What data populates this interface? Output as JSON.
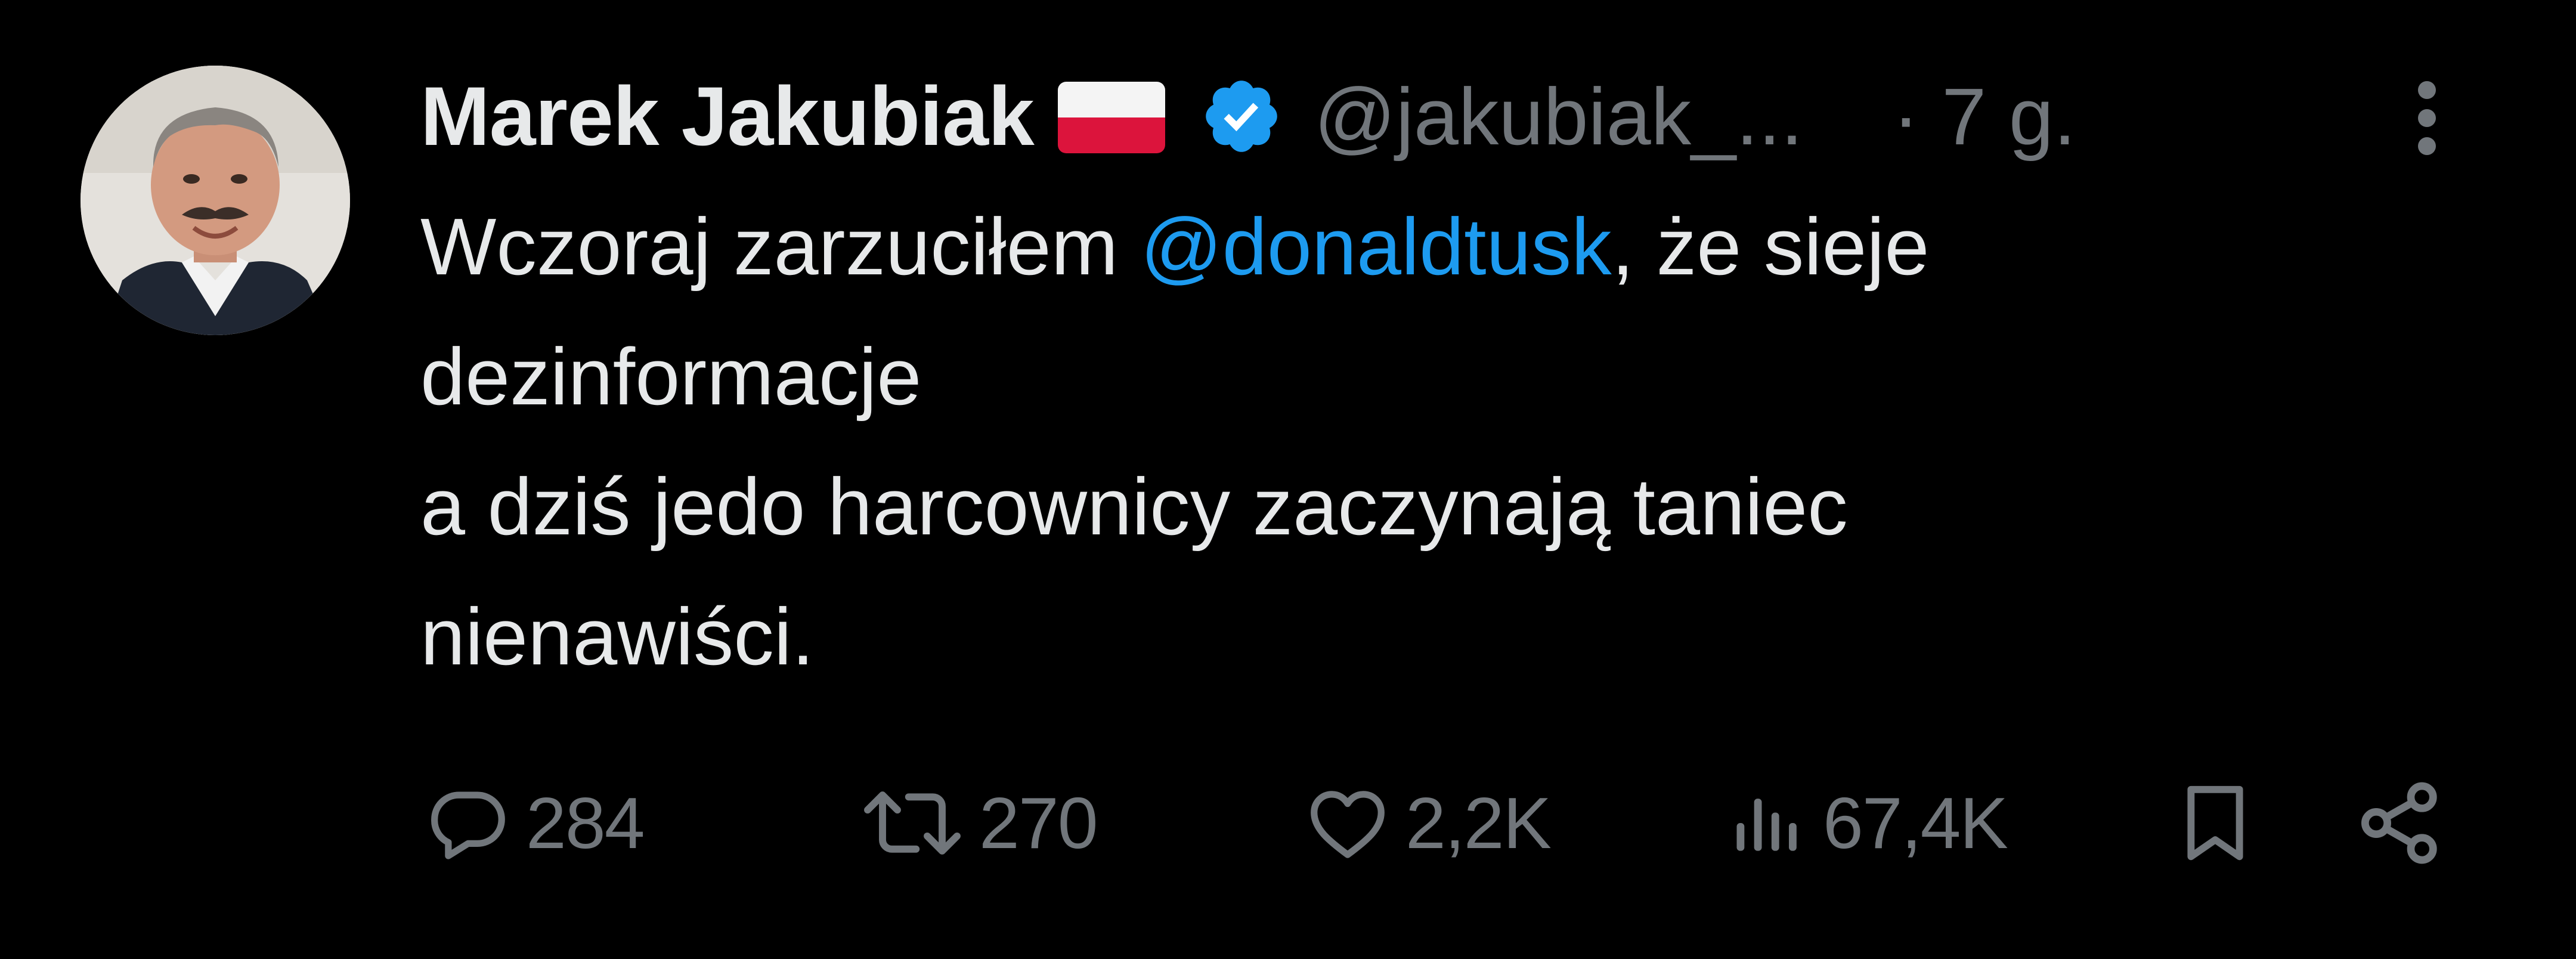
{
  "tweet": {
    "author": {
      "display_name": "Marek Jakubiak",
      "flag_icon": "poland-flag-icon",
      "verified_icon": "verified-badge-icon",
      "handle": "@jakubiak_...",
      "time": "· 7 g."
    },
    "body": {
      "line1_before": "Wczoraj zarzuciłem ",
      "mention": "@donaldtusk",
      "line1_after": ", że sieje",
      "line2": "dezinformacje",
      "line3": "a dziś jedo harcownicy zaczynają taniec",
      "line4": "nienawiści."
    },
    "actions": {
      "replies": "284",
      "retweets": "270",
      "likes": "2,2K",
      "views": "67,4K"
    }
  },
  "colors": {
    "background": "#000000",
    "text": "#e7e9ea",
    "secondary": "#71767b",
    "accent": "#1d9bf0"
  }
}
